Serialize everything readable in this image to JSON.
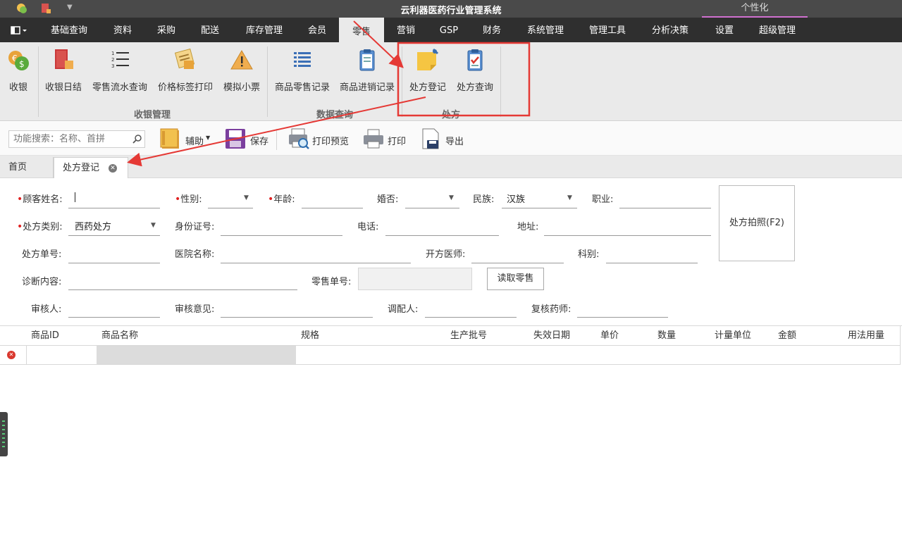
{
  "app": {
    "title": "云利器医药行业管理系统",
    "personalize": "个性化"
  },
  "menu": {
    "items": [
      "基础查询",
      "资料",
      "采购",
      "配送",
      "库存管理",
      "会员",
      "零售",
      "营销",
      "GSP",
      "财务",
      "系统管理",
      "管理工具",
      "分析决策",
      "设置",
      "超级管理"
    ],
    "active": "零售"
  },
  "ribbon": {
    "buttons": {
      "cashier": "收银",
      "daily": "收银日结",
      "flow": "零售流水查询",
      "label_print": "价格标签打印",
      "mock_ticket": "模拟小票",
      "retail_record": "商品零售记录",
      "inout_record": "商品进销记录",
      "rx_register": "处方登记",
      "rx_query": "处方查询"
    },
    "groups": {
      "cash": "收银管理",
      "data": "数据查询",
      "rx": "处方"
    }
  },
  "toolbar": {
    "search_placeholder": "功能搜索：名称、首拼",
    "assist": "辅助",
    "save": "保存",
    "print_preview": "打印预览",
    "print": "打印",
    "export": "导出"
  },
  "tabs": {
    "home": "首页",
    "current": "处方登记"
  },
  "form": {
    "customer_name": "顾客姓名:",
    "gender": "性别:",
    "age": "年龄:",
    "marital": "婚否:",
    "ethnicity": "民族:",
    "ethnicity_value": "汉族",
    "occupation": "职业:",
    "rx_type": "处方类别:",
    "rx_type_value": "西药处方",
    "id_number": "身份证号:",
    "phone": "电话:",
    "address": "地址:",
    "rx_number": "处方单号:",
    "hospital": "医院名称:",
    "doctor": "开方医师:",
    "department": "科别:",
    "diagnosis": "诊断内容:",
    "retail_number": "零售单号:",
    "read_retail": "读取零售",
    "reviewer": "审核人:",
    "review_opinion": "审核意见:",
    "dispenser": "调配人:",
    "recheck_pharmacist": "复核药师:",
    "photo_button": "处方拍照(F2)"
  },
  "table": {
    "columns": [
      "商品ID",
      "商品名称",
      "规格",
      "生产批号",
      "失效日期",
      "单价",
      "数量",
      "计量单位",
      "金额",
      "用法用量"
    ]
  }
}
